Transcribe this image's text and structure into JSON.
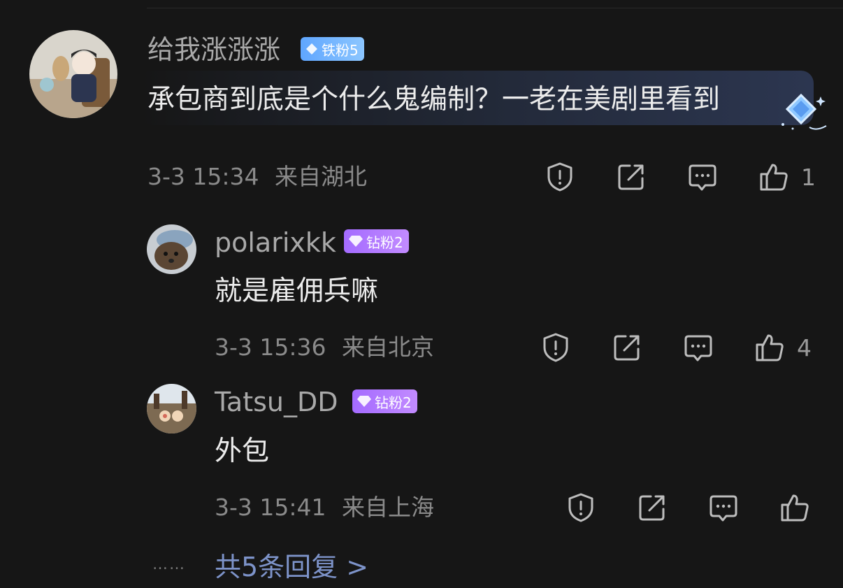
{
  "main_comment": {
    "username": "给我涨涨涨",
    "badge": "铁粉5",
    "text": "承包商到底是个什么鬼编制？一老在美剧里看到",
    "time": "3-3 15:34",
    "location": "来自湖北",
    "likes": "1"
  },
  "replies": [
    {
      "username": "polarixkk",
      "badge": "钻粉2",
      "text": "就是雇佣兵嘛",
      "time": "3-3 15:36",
      "location": "来自北京",
      "likes": "4"
    },
    {
      "username": "Tatsu_DD",
      "badge": "钻粉2",
      "text": "外包",
      "time": "3-3 15:41",
      "location": "来自上海",
      "likes": ""
    }
  ],
  "more": {
    "dots": "……",
    "label": "共5条回复 >"
  },
  "icons": {
    "report": "report-icon",
    "share": "share-icon",
    "comment": "comment-icon",
    "like": "thumbs-up-icon"
  },
  "colors": {
    "background": "#161616",
    "badge_blue": "#6fb2ff",
    "badge_purple": "#b07bff",
    "link": "#7d93c9"
  }
}
